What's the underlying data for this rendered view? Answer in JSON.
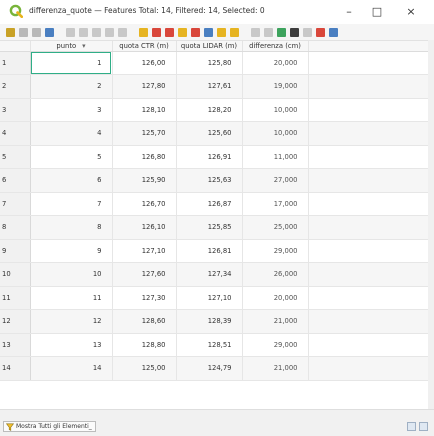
{
  "window": {
    "title": "differenza_quote — Features Total: 14, Filtered: 14, Selected: 0",
    "minimize_label": "–",
    "maximize_label": "□",
    "close_label": "×"
  },
  "toolbar": {
    "icons": [
      "pencil-icon",
      "toggle-editing-icon",
      "save-edits-icon",
      "reload-icon",
      "add-feature-icon",
      "delete-feature-icon",
      "cut-icon",
      "copy-icon",
      "paste-icon",
      "select-expression-icon",
      "select-all-icon",
      "invert-selection-icon",
      "deselect-icon",
      "filter-select-icon",
      "move-selection-top-icon",
      "pan-to-selection-icon",
      "zoom-to-selection-icon",
      "copy-rows-icon",
      "paste-rows-icon",
      "new-field-icon",
      "delete-field-icon",
      "field-calculator-icon",
      "conditional-formatting-icon",
      "dock-icon"
    ],
    "colors": {
      "edit": "#c9a227",
      "gray": "#b9b9b9",
      "red": "#d9473b",
      "green": "#3da35d",
      "blue": "#4a7fc1",
      "yellow": "#e6b422"
    }
  },
  "table": {
    "columns": [
      "punto",
      "quota CTR (m)",
      "quota LIDAR (m)",
      "differenza (cm)"
    ],
    "sort_indicator": "▾",
    "rows": [
      {
        "id": "1",
        "punto": "1",
        "ctr": "126,00",
        "lidar": "125,80",
        "diff": "20,000"
      },
      {
        "id": "2",
        "punto": "2",
        "ctr": "127,80",
        "lidar": "127,61",
        "diff": "19,000"
      },
      {
        "id": "3",
        "punto": "3",
        "ctr": "128,10",
        "lidar": "128,20",
        "diff": "10,000"
      },
      {
        "id": "4",
        "punto": "4",
        "ctr": "125,70",
        "lidar": "125,60",
        "diff": "10,000"
      },
      {
        "id": "5",
        "punto": "5",
        "ctr": "126,80",
        "lidar": "126,91",
        "diff": "11,000"
      },
      {
        "id": "6",
        "punto": "6",
        "ctr": "125,90",
        "lidar": "125,63",
        "diff": "27,000"
      },
      {
        "id": "7",
        "punto": "7",
        "ctr": "126,70",
        "lidar": "126,87",
        "diff": "17,000"
      },
      {
        "id": "8",
        "punto": "8",
        "ctr": "126,10",
        "lidar": "125,85",
        "diff": "25,000"
      },
      {
        "id": "9",
        "punto": "9",
        "ctr": "127,10",
        "lidar": "126,81",
        "diff": "29,000"
      },
      {
        "id": "10",
        "punto": "10",
        "ctr": "127,60",
        "lidar": "127,34",
        "diff": "26,000"
      },
      {
        "id": "11",
        "punto": "11",
        "ctr": "127,30",
        "lidar": "127,10",
        "diff": "20,000"
      },
      {
        "id": "12",
        "punto": "12",
        "ctr": "128,60",
        "lidar": "128,39",
        "diff": "21,000"
      },
      {
        "id": "13",
        "punto": "13",
        "ctr": "128,80",
        "lidar": "128,51",
        "diff": "29,000"
      },
      {
        "id": "14",
        "punto": "14",
        "ctr": "125,00",
        "lidar": "124,79",
        "diff": "21,000"
      }
    ]
  },
  "statusbar": {
    "filter_label": "Mostra Tutti gli Elementi_"
  }
}
